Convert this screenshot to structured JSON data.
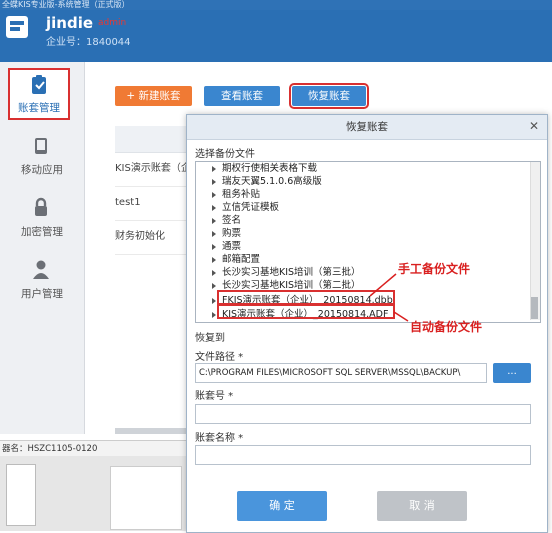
{
  "window": {
    "title": "全蝶KIS专业版-系统管理（正式版）"
  },
  "header": {
    "user": "jindie",
    "user_badge": "admin",
    "corp_label": "企业号：",
    "corp_id": "1840044"
  },
  "sidebar": {
    "items": [
      {
        "label": "账套管理",
        "icon": "account-set-icon"
      },
      {
        "label": "移动应用",
        "icon": "mobile-icon"
      },
      {
        "label": "加密管理",
        "icon": "lock-icon"
      },
      {
        "label": "用户管理",
        "icon": "user-icon"
      }
    ]
  },
  "toolbar": {
    "new_label": "+ 新建账套",
    "view_label": "查看账套",
    "restore_label": "恢复账套"
  },
  "list": {
    "rows": [
      "KIS演示账套（企",
      "test1",
      "财务初始化"
    ]
  },
  "status": {
    "machine": "器名：HSZC1105-0120"
  },
  "dialog": {
    "title": "恢复账套",
    "select_label": "选择备份文件",
    "files": [
      "期权行使相关表格下载",
      "瑞友天翼5.1.0.6高级版",
      "租务补贴",
      "立信凭证模板",
      "签名",
      "购票",
      "通票",
      "邮箱配置",
      "长沙实习基地KIS培训（第三批）",
      "长沙实习基地KIS培训（第二批）",
      "FKIS演示账套（企业）_20150814.dbb",
      "KIS演示账套（企业）_20150814.ADF"
    ],
    "restore_to_label": "恢复到",
    "path_label": "文件路径 *",
    "path_value": "C:\\PROGRAM FILES\\MICROSOFT SQL SERVER\\MSSQL\\BACKUP\\",
    "browse_label": "...",
    "account_no_label": "账套号 *",
    "account_no_value": "",
    "account_name_label": "账套名称 *",
    "account_name_value": "",
    "ok_label": "确 定",
    "cancel_label": "取 消"
  },
  "annotations": {
    "manual": "手工备份文件",
    "auto": "自动备份文件"
  },
  "colors": {
    "accent": "#2a6fb4",
    "orange": "#f07a34",
    "highlight": "#d93030"
  }
}
